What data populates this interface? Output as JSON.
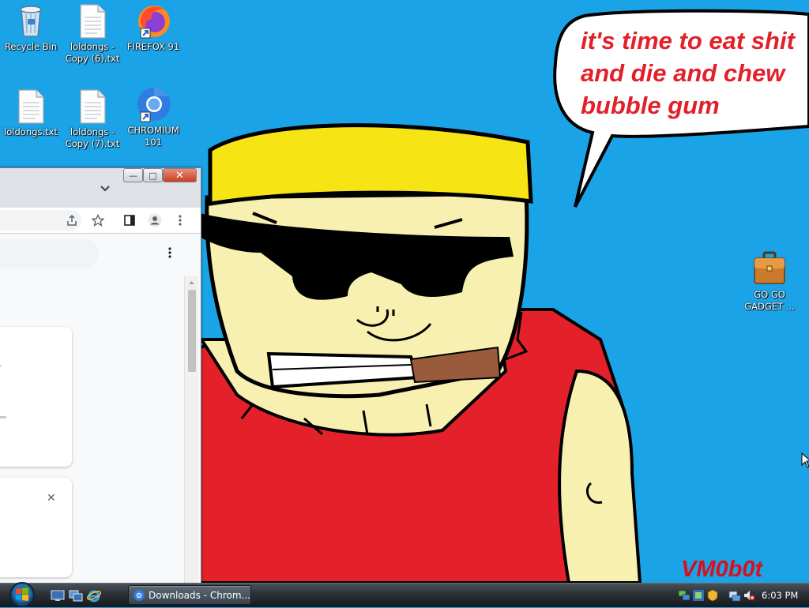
{
  "desktop": {
    "icons": [
      {
        "label": "Recycle Bin",
        "icon": "recycle-bin-icon"
      },
      {
        "label": "loldongs - Copy (6).txt",
        "icon": "text-file-icon"
      },
      {
        "label": "FIREFOX 91",
        "icon": "firefox-icon"
      },
      {
        "label": "loldongs.txt",
        "icon": "text-file-icon"
      },
      {
        "label": "loldongs - Copy (7).txt",
        "icon": "text-file-icon"
      },
      {
        "label": "CHROMIUM 101",
        "icon": "chromium-icon"
      },
      {
        "label": "GO GO GADGET ...",
        "icon": "briefcase-icon"
      }
    ],
    "wallpaper": {
      "speech_lines": [
        "it's time to eat shit",
        "and die and chew",
        "bubble gum"
      ],
      "signature": "VM0b0t",
      "colors": {
        "sky": "#1aa3e6",
        "skin": "#f8f0b0",
        "hat": "#f6e415",
        "shirt": "#e4202a",
        "cigar": "#9a5a3c",
        "text": "#e3202a"
      }
    }
  },
  "browser": {
    "caption_buttons": {
      "minimize": "—",
      "maximize": "□",
      "close": "✕"
    },
    "icons": [
      "chevron-down-icon",
      "share-icon",
      "star-icon",
      "side-panel-icon",
      "profile-icon",
      "more-vert-icon"
    ],
    "card_close": "✕",
    "card_ellipsis": "..."
  },
  "taskbar": {
    "task_button_label": "Downloads - Chrom...",
    "clock": "6:03 PM",
    "colors": {
      "bar": "#2a3036",
      "button": "#4a5662"
    }
  }
}
